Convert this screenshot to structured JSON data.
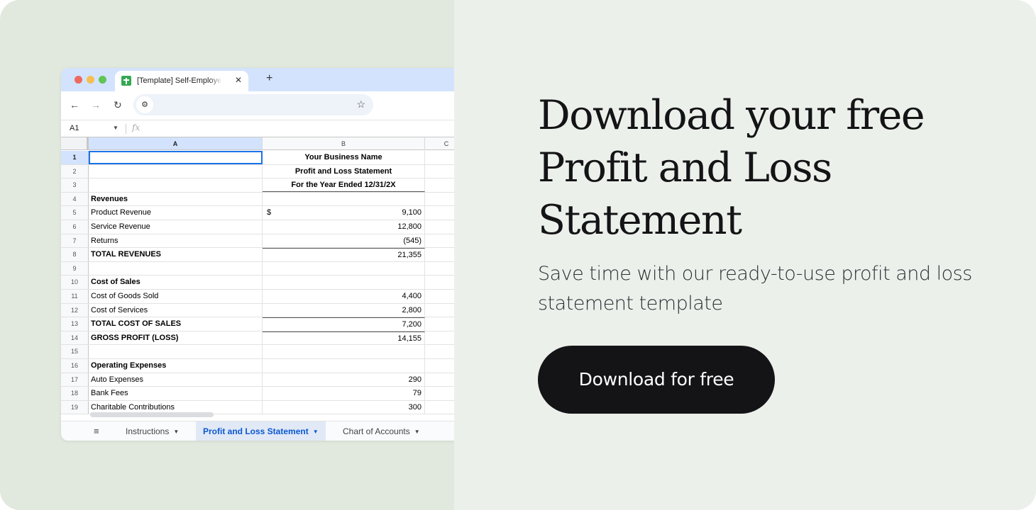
{
  "browser": {
    "tab_title": "[Template] Self-Employed Profit and Loss Statement",
    "tab_close": "✕",
    "new_tab": "+",
    "nav_back": "←",
    "nav_forward": "→",
    "nav_reload": "↻",
    "site_settings_icon": "⚙",
    "bookmark_star": "☆"
  },
  "sheet": {
    "name_box": "A1",
    "name_box_arrow": "▼",
    "fx_label": "fx",
    "columns": [
      "A",
      "B",
      "C"
    ],
    "rows": [
      {
        "num": "1",
        "a": "",
        "b": "Your Business Name"
      },
      {
        "num": "2",
        "a": "",
        "b": "Profit and Loss Statement"
      },
      {
        "num": "3",
        "a": "",
        "b": "For the Year Ended 12/31/2X"
      },
      {
        "num": "4",
        "a": "Revenues",
        "b": ""
      },
      {
        "num": "5",
        "a": "Product Revenue",
        "b": "9,100",
        "currency": "$"
      },
      {
        "num": "6",
        "a": "Service Revenue",
        "b": "12,800"
      },
      {
        "num": "7",
        "a": "Returns",
        "b": "(545)"
      },
      {
        "num": "8",
        "a": "TOTAL REVENUES",
        "b": "21,355"
      },
      {
        "num": "9",
        "a": "",
        "b": ""
      },
      {
        "num": "10",
        "a": "Cost of Sales",
        "b": ""
      },
      {
        "num": "11",
        "a": "Cost of Goods Sold",
        "b": "4,400"
      },
      {
        "num": "12",
        "a": "Cost of Services",
        "b": "2,800"
      },
      {
        "num": "13",
        "a": "TOTAL COST OF SALES",
        "b": "7,200"
      },
      {
        "num": "14",
        "a": "GROSS PROFIT (LOSS)",
        "b": "14,155"
      },
      {
        "num": "15",
        "a": "",
        "b": ""
      },
      {
        "num": "16",
        "a": "Operating Expenses",
        "b": ""
      },
      {
        "num": "17",
        "a": "Auto Expenses",
        "b": "290"
      },
      {
        "num": "18",
        "a": "Bank Fees",
        "b": "79"
      },
      {
        "num": "19",
        "a": "Charitable Contributions",
        "b": "300"
      }
    ],
    "sheets_menu_icon": "≡",
    "tabs": [
      {
        "label": "Instructions",
        "active": false
      },
      {
        "label": "Profit and Loss Statement",
        "active": true
      },
      {
        "label": "Chart of Accounts",
        "active": false
      }
    ],
    "tab_dropdown": "▼"
  },
  "promo": {
    "headline_lines": [
      "Download your free",
      "Profit and Loss",
      "Statement"
    ],
    "subtext": "Save time with our ready-to-use profit and loss statement template",
    "cta_label": "Download for free"
  },
  "colors": {
    "left_bg": "#e1e8dd",
    "right_bg": "#ecf0eb",
    "cta_bg": "#141416",
    "sheet_accent": "#0b57d0",
    "tab_strip": "#d3e3fd"
  }
}
